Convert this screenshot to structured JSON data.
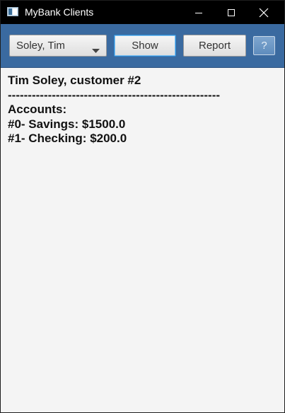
{
  "window": {
    "title": "MyBank Clients",
    "controls": {
      "minimize": "minimize",
      "maximize": "maximize",
      "close": "close"
    }
  },
  "toolbar": {
    "client_select": {
      "selected": "Soley, Tim"
    },
    "show_label": "Show",
    "report_label": "Report",
    "help_label": "?"
  },
  "output": {
    "lines": [
      "Tim Soley, customer #2",
      "-----------------------------------------------------",
      "Accounts:",
      "#0- Savings: $1500.0",
      "#1- Checking: $200.0"
    ]
  },
  "colors": {
    "titlebar": "#000000",
    "toolbar": "#3a6aa0",
    "content_bg": "#f4f4f4",
    "focus_border": "#2d8bd6"
  }
}
